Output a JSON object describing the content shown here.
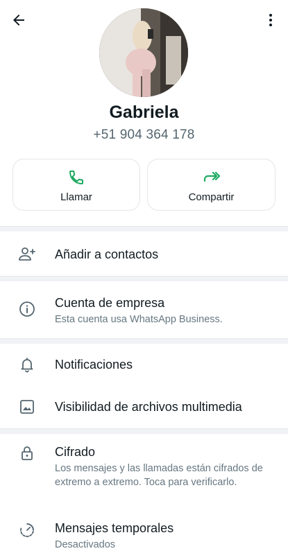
{
  "contact": {
    "name": "Gabriela",
    "phone": "+51 904 364 178"
  },
  "actions": {
    "call_label": "Llamar",
    "share_label": "Compartir"
  },
  "rows": {
    "add_contact": "Añadir a contactos",
    "business_title": "Cuenta de empresa",
    "business_sub": "Esta cuenta usa WhatsApp Business.",
    "notifications": "Notificaciones",
    "media_visibility": "Visibilidad de archivos multimedia",
    "encryption_title": "Cifrado",
    "encryption_sub": "Los mensajes y las llamadas están cifrados de extremo a extremo. Toca para verificarlo.",
    "disappearing_title": "Mensajes temporales",
    "disappearing_sub": "Desactivados"
  },
  "colors": {
    "accent": "#1daa61",
    "icon": "#54656f",
    "separator": "#f0f2f5"
  },
  "icons": {
    "back": "arrow-left-icon",
    "more": "more-vertical-icon",
    "call": "phone-icon",
    "share": "forward-icon",
    "add_contact": "person-add-icon",
    "business": "info-icon",
    "notifications": "bell-icon",
    "media": "image-icon",
    "encryption": "lock-icon",
    "disappearing": "timer-icon"
  }
}
